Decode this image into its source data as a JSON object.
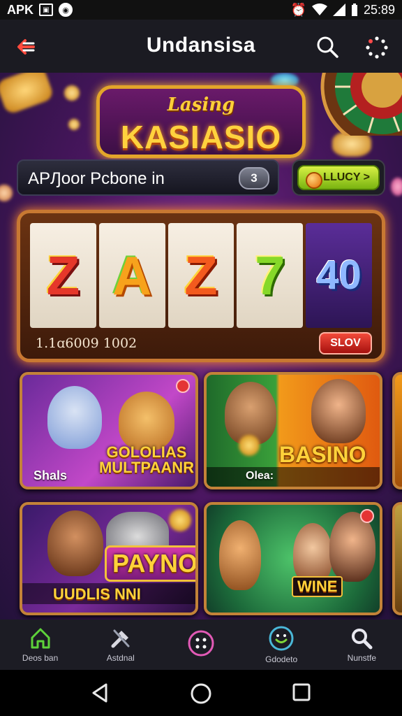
{
  "status_bar": {
    "left_text": "APK",
    "time": "25:89"
  },
  "app_bar": {
    "title": "Undansisa",
    "back_icon": "arrow-left-icon",
    "search_icon": "search-icon",
    "menu_icon": "loading-dots-icon"
  },
  "hero": {
    "logo_small": "Lasing",
    "logo_big": "KASIASIO",
    "promo_text": "APԒoor Pcbone in",
    "promo_badge": "3",
    "lucky_button": "LLUCY >"
  },
  "slot_machine": {
    "reels": [
      "Z",
      "A",
      "Z",
      "7",
      "40"
    ],
    "footer_number": "1.1ɑ6009 1002",
    "spin_button": "SLOV"
  },
  "games": [
    {
      "title": "GOLOLIAS MULTPAANR",
      "subtitle": "Shals"
    },
    {
      "title": "BASINO",
      "subtitle": "Olea:"
    },
    {
      "title": "PAYNO",
      "subtitle": "UUDLIS NNI"
    },
    {
      "title": "WINE",
      "subtitle": ""
    }
  ],
  "bottom_nav": [
    {
      "label": "Deos ban",
      "icon": "home-icon"
    },
    {
      "label": "Astdnal",
      "icon": "tools-icon"
    },
    {
      "label": "",
      "icon": "grid-circle-icon"
    },
    {
      "label": "Gdodeto",
      "icon": "smile-icon"
    },
    {
      "label": "Nunstfe",
      "icon": "search-icon"
    }
  ],
  "colors": {
    "accent_gold": "#ffd23e",
    "accent_green": "#7fd63a",
    "accent_red": "#e43434",
    "background_purple": "#4a1660"
  }
}
